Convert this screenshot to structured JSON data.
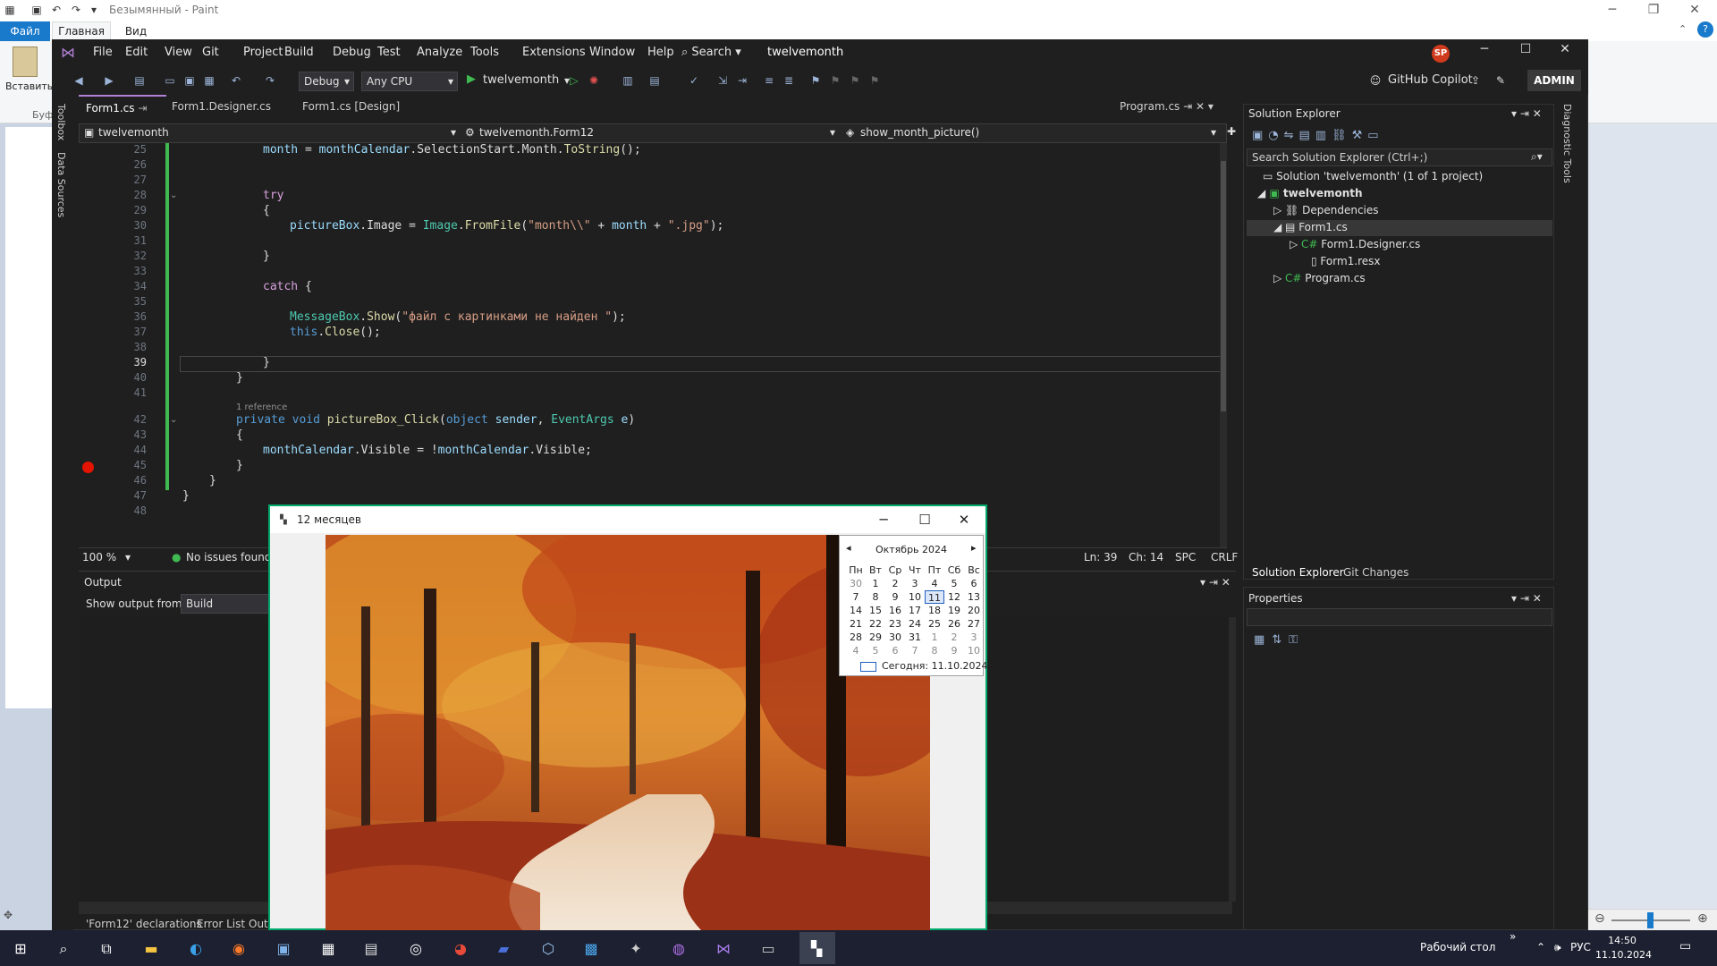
{
  "paint": {
    "title": "Безымянный - Paint",
    "tabs": {
      "file": "Файл",
      "home": "Главная",
      "view": "Вид"
    },
    "paste_label": "Вставить",
    "clipboard_group": "Буф"
  },
  "vs": {
    "menu": [
      "File",
      "Edit",
      "View",
      "Git",
      "Project",
      "Build",
      "Debug",
      "Test",
      "Analyze",
      "Tools",
      "Extensions",
      "Window",
      "Help"
    ],
    "search_label": "Search",
    "app_name": "twelvemonth",
    "avatar": "SP",
    "toolbar": {
      "config": "Debug",
      "platform": "Any CPU",
      "run_target": "twelvemonth",
      "copilot": "GitHub Copilot",
      "admin": "ADMIN"
    },
    "side_tabs": [
      "Toolbox",
      "Data Sources"
    ],
    "doc_tabs": [
      "Form1.cs",
      "Form1.Designer.cs",
      "Form1.cs [Design]"
    ],
    "doc_tab_right": "Program.cs",
    "nav": {
      "project": "twelvemonth",
      "class": "twelvemonth.Form12",
      "member": "show_month_picture()"
    },
    "editor": {
      "ref_hint": "1 reference",
      "lines": [
        "25",
        "26",
        "27",
        "28",
        "29",
        "30",
        "31",
        "32",
        "33",
        "34",
        "35",
        "36",
        "37",
        "38",
        "39",
        "40",
        "41",
        "42",
        "43",
        "44",
        "45",
        "46",
        "47",
        "48"
      ],
      "current_line": "39"
    },
    "status": {
      "zoom": "100 %",
      "issues": "No issues found",
      "ln": "Ln: 39",
      "ch": "Ch: 14",
      "spc": "SPC",
      "eol": "CRLF"
    },
    "output": {
      "title": "Output",
      "from_label": "Show output from:",
      "from_value": "Build",
      "bottom_tabs": [
        "'Form12' declarations",
        "Error List",
        "Out"
      ]
    },
    "solution": {
      "title": "Solution Explorer",
      "search": "Search Solution Explorer (Ctrl+;)",
      "items": [
        {
          "label": "Solution 'twelvemonth' (1 of 1 project)"
        },
        {
          "label": "twelvemonth"
        },
        {
          "label": "Dependencies"
        },
        {
          "label": "Form1.cs"
        },
        {
          "label": "Form1.Designer.cs"
        },
        {
          "label": "Form1.resx"
        },
        {
          "label": "Program.cs"
        }
      ],
      "tabs": [
        "Solution Explorer",
        "Git Changes"
      ]
    },
    "properties": {
      "title": "Properties"
    },
    "diagnostic_tab": "Diagnostic Tools"
  },
  "app": {
    "title": "12 месяцев",
    "calendar": {
      "month_title": "Октябрь 2024",
      "weekdays": [
        "Пн",
        "Вт",
        "Ср",
        "Чт",
        "Пт",
        "Сб",
        "Вс"
      ],
      "rows": [
        [
          "30",
          "1",
          "2",
          "3",
          "4",
          "5",
          "6"
        ],
        [
          "7",
          "8",
          "9",
          "10",
          "11",
          "12",
          "13"
        ],
        [
          "14",
          "15",
          "16",
          "17",
          "18",
          "19",
          "20"
        ],
        [
          "21",
          "22",
          "23",
          "24",
          "25",
          "26",
          "27"
        ],
        [
          "28",
          "29",
          "30",
          "31",
          "1",
          "2",
          "3"
        ],
        [
          "4",
          "5",
          "6",
          "7",
          "8",
          "9",
          "10"
        ]
      ],
      "today_label": "Сегодня: 11.10.2024",
      "selected": "11"
    }
  },
  "taskbar": {
    "desktop_label": "Рабочий стол",
    "lang": "РУС",
    "time": "14:50",
    "date": "11.10.2024"
  }
}
